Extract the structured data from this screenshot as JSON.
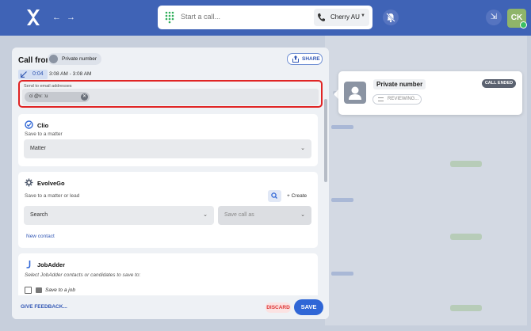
{
  "header": {
    "call_placeholder": "Start a call...",
    "region_label": "Cherry AU",
    "avatar_initials": "CK",
    "brand_color": "#3f63b6"
  },
  "modal": {
    "title": "Call from",
    "caller_chip": "Private number",
    "share_label": "SHARE",
    "duration": "0:04",
    "time_range": "3:08 AM - 3:08 AM",
    "email": {
      "label": "Send to email addresses",
      "chip_value": "ci          @v:    :u"
    },
    "clio": {
      "title": "Clio",
      "subtitle": "Save to a matter",
      "dropdown_label": "Matter"
    },
    "evolvego": {
      "title": "EvolveGo",
      "subtitle": "Save to a matter or lead",
      "create_label": "Create",
      "search_label": "Search",
      "save_as_label": "Save call as",
      "new_contact_label": "New contact"
    },
    "jobadder": {
      "title": "JobAdder",
      "subtitle": "Select JobAdder contacts or candidates to save to:",
      "checkbox_label": "Save to a job"
    },
    "footer": {
      "feedback_label": "GIVE FEEDBACK...",
      "discard_label": "DISCARD",
      "save_label": "SAVE"
    }
  },
  "popup": {
    "name": "Private number",
    "status": "REVIEWING...",
    "badge": "CALL ENDED"
  }
}
